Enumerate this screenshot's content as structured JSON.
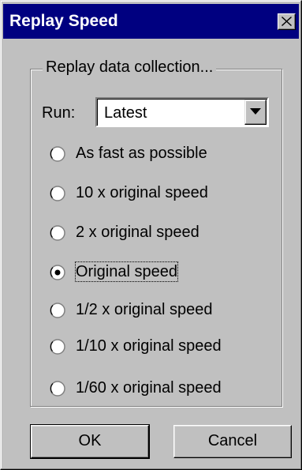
{
  "window": {
    "title": "Replay Speed",
    "close_glyph": "✕"
  },
  "group": {
    "label": "Replay data collection..."
  },
  "run": {
    "label": "Run:",
    "selected": "Latest"
  },
  "speed_options": {
    "items": [
      {
        "label": "As fast as possible",
        "selected": false
      },
      {
        "label": "10 x original speed",
        "selected": false
      },
      {
        "label": "2 x original speed",
        "selected": false
      },
      {
        "label": "Original speed",
        "selected": true
      },
      {
        "label": "1/2 x original speed",
        "selected": false
      },
      {
        "label": "1/10 x original speed",
        "selected": false
      },
      {
        "label": "1/60 x original speed",
        "selected": false
      }
    ]
  },
  "buttons": {
    "ok_label": "OK",
    "cancel_label": "Cancel"
  },
  "colors": {
    "title_bar": "#000080",
    "face": "#c0c0c0"
  }
}
